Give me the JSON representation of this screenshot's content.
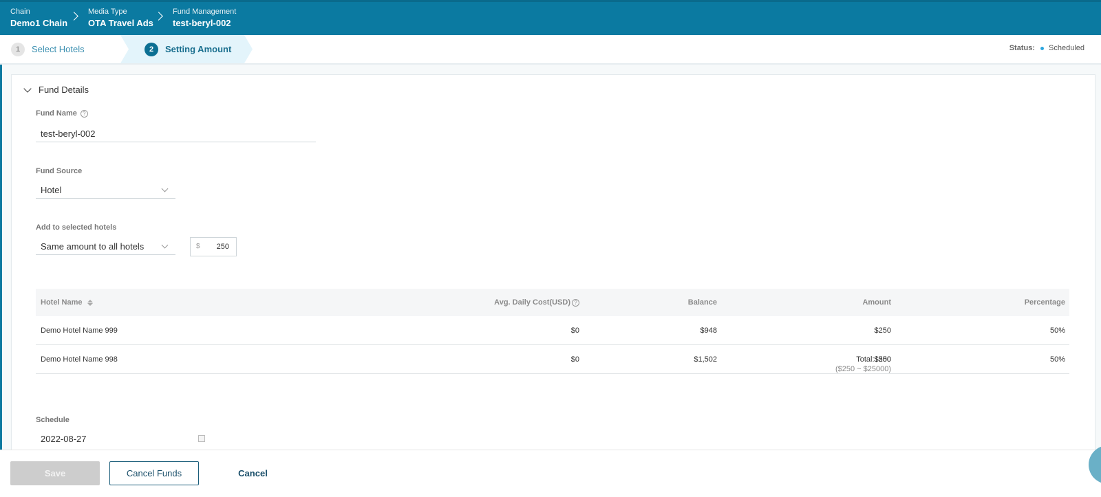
{
  "breadcrumb": [
    {
      "label": "Chain",
      "value": "Demo1 Chain"
    },
    {
      "label": "Media Type",
      "value": "OTA Travel Ads"
    },
    {
      "label": "Fund Management",
      "value": "test-beryl-002"
    }
  ],
  "steps": [
    {
      "num": "1",
      "label": "Select Hotels"
    },
    {
      "num": "2",
      "label": "Setting Amount"
    }
  ],
  "status": {
    "label": "Status:",
    "value": "Scheduled",
    "color": "#2ba6de"
  },
  "section": {
    "title": "Fund Details"
  },
  "form": {
    "fund_name_label": "Fund Name",
    "fund_name_value": "test-beryl-002",
    "fund_source_label": "Fund Source",
    "fund_source_value": "Hotel",
    "add_label": "Add to selected hotels",
    "add_mode": "Same amount to all hotels",
    "currency": "$",
    "amount": "250"
  },
  "table": {
    "headers": [
      "Hotel Name",
      "Avg. Daily Cost(USD)",
      "Balance",
      "Amount",
      "Percentage"
    ],
    "rows": [
      [
        "Demo Hotel Name 999",
        "$0",
        "$948",
        "$250",
        "50%"
      ],
      [
        "Demo Hotel Name 998",
        "$0",
        "$1,502",
        "$250",
        "50%"
      ]
    ],
    "total": "Total:$500",
    "range": "($250 ~ $25000)"
  },
  "schedule": {
    "label": "Schedule",
    "date": "2022-08-27"
  },
  "footer": {
    "save": "Save",
    "cancel_funds": "Cancel Funds",
    "cancel": "Cancel"
  },
  "colors": {
    "header": "#0b7aa1",
    "accent": "#0b6f93"
  }
}
